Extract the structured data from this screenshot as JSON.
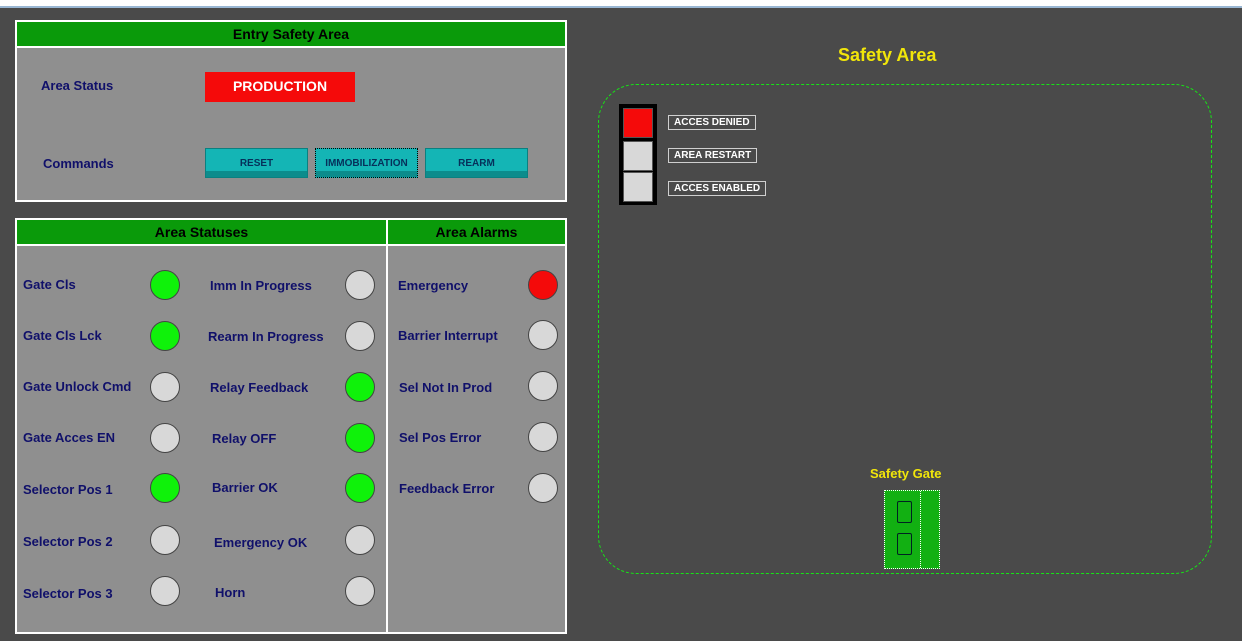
{
  "entry": {
    "title": "Entry Safety Area",
    "area_status_label": "Area Status",
    "area_status_value": "PRODUCTION",
    "commands_label": "Commands",
    "buttons": [
      "RESET",
      "IMMOBILIZATION",
      "REARM"
    ]
  },
  "statuses": {
    "title": "Area Statuses",
    "left": [
      {
        "label": "Gate Cls",
        "state": "green"
      },
      {
        "label": "Gate Cls Lck",
        "state": "green"
      },
      {
        "label": "Gate Unlock Cmd",
        "state": "off"
      },
      {
        "label": "Gate Acces EN",
        "state": "off"
      },
      {
        "label": "Selector Pos 1",
        "state": "green"
      },
      {
        "label": "Selector Pos 2",
        "state": "off"
      },
      {
        "label": "Selector Pos 3",
        "state": "off"
      }
    ],
    "right": [
      {
        "label": "Imm In Progress",
        "state": "off"
      },
      {
        "label": "Rearm In Progress",
        "state": "off"
      },
      {
        "label": "Relay Feedback",
        "state": "green"
      },
      {
        "label": "Relay OFF",
        "state": "green"
      },
      {
        "label": "Barrier OK",
        "state": "green"
      },
      {
        "label": "Emergency OK",
        "state": "off"
      },
      {
        "label": "Horn",
        "state": "off"
      }
    ]
  },
  "alarms": {
    "title": "Area Alarms",
    "items": [
      {
        "label": "Emergency",
        "state": "red"
      },
      {
        "label": "Barrier Interrupt",
        "state": "off"
      },
      {
        "label": "Sel Not In Prod",
        "state": "off"
      },
      {
        "label": "Sel Pos Error",
        "state": "off"
      },
      {
        "label": "Feedback Error",
        "state": "off"
      }
    ]
  },
  "safety_area": {
    "title": "Safety Area",
    "indicators": [
      {
        "label": "ACCES DENIED",
        "state": "red"
      },
      {
        "label": "AREA RESTART",
        "state": "off"
      },
      {
        "label": "ACCES ENABLED",
        "state": "off"
      }
    ],
    "gate_label": "Safety Gate"
  },
  "colors": {
    "header_green": "#0a9a0a",
    "lamp_green": "#0ff20a",
    "lamp_red": "#f40a0a",
    "lamp_off": "#d8d8d8",
    "title_yellow": "#f1e60a",
    "button_teal": "#14b5b5"
  }
}
